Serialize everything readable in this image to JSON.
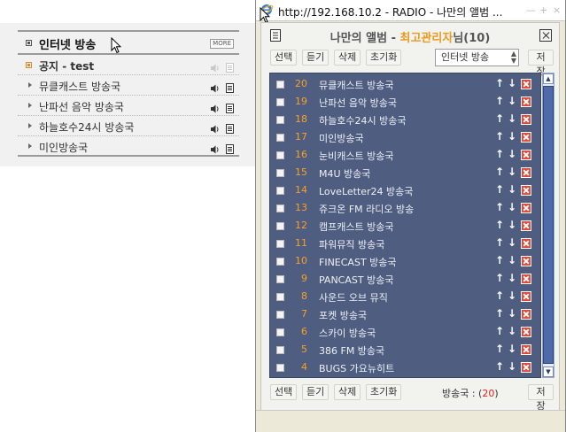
{
  "widget": {
    "title": "인터넷 방송",
    "more_label": "MORE",
    "items": [
      {
        "label": "공지 - test",
        "type": "notice"
      },
      {
        "label": "뮤클캐스트 방송국",
        "type": "station"
      },
      {
        "label": "난파선 음악 방송국",
        "type": "station"
      },
      {
        "label": "하늘호수24시 방송국",
        "type": "station"
      },
      {
        "label": "미인방송국",
        "type": "station"
      }
    ]
  },
  "popup": {
    "window_title": "http://192.168.10.2 - RADIO - 나만의 앨범 ...",
    "header_title_prefix": "나만의 앨범 - ",
    "header_admin": "최고관리자",
    "header_suffix": "님(10)",
    "toolbar_top": {
      "select_label": "선택",
      "listen_label": "듣기",
      "delete_label": "삭제",
      "reset_label": "초기화",
      "category_value": "인터넷 방송",
      "save_label": "저장"
    },
    "toolbar_bottom": {
      "select_label": "선택",
      "listen_label": "듣기",
      "delete_label": "삭제",
      "reset_label": "초기화",
      "count_label": "방송국 : (",
      "count_value": "20",
      "count_close": ")",
      "save_label": "저장"
    },
    "stations": [
      {
        "num": "20",
        "name": "뮤클캐스트 방송국"
      },
      {
        "num": "19",
        "name": "난파선 음악 방송국"
      },
      {
        "num": "18",
        "name": "하늘호수24시 방송국"
      },
      {
        "num": "17",
        "name": "미인방송국"
      },
      {
        "num": "16",
        "name": "눈비캐스트 방송국"
      },
      {
        "num": "15",
        "name": "M4U 방송국"
      },
      {
        "num": "14",
        "name": "LoveLetter24 방송국"
      },
      {
        "num": "13",
        "name": "쥬크온 FM 라디오 방송"
      },
      {
        "num": "12",
        "name": "캠프캐스트 방송국"
      },
      {
        "num": "11",
        "name": "파워뮤직 방송국"
      },
      {
        "num": "10",
        "name": "FINECAST 방송국"
      },
      {
        "num": "9",
        "name": "PANCAST 방송국"
      },
      {
        "num": "8",
        "name": "사운드 오브 뮤직"
      },
      {
        "num": "7",
        "name": "포켓 방송국"
      },
      {
        "num": "6",
        "name": "스카이 방송국"
      },
      {
        "num": "5",
        "name": "386 FM 방송국"
      },
      {
        "num": "4",
        "name": "BUGS 가요뉴히트"
      }
    ],
    "glyphs": {
      "up": "↑",
      "down": "↓",
      "scroll_up": "▲",
      "scroll_down": "▼",
      "select_arrows": "▲▼"
    }
  },
  "colors": {
    "list_bg": "#4e5d80",
    "number": "#f4a128",
    "admin": "#e99a20",
    "delete": "#e04a3a",
    "count": "#dd2222"
  }
}
